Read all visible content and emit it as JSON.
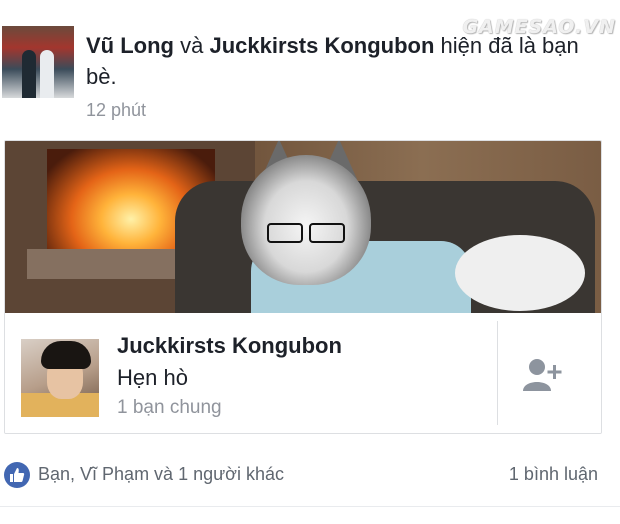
{
  "story": {
    "actor_one": "Vũ Long",
    "connector": "và",
    "actor_two": "Juckkirsts Kongubon",
    "action": "hiện đã là bạn bè.",
    "time": "12 phút"
  },
  "watermark": "GAMESAO.VN",
  "friend_card": {
    "name": "Juckkirsts Kongubon",
    "status": "Hẹn hò",
    "mutual": "1 bạn chung"
  },
  "footer": {
    "reactions": "Bạn, Vĩ Phạm và 1 người khác",
    "comments": "1 bình luận"
  },
  "colors": {
    "accent": "#4267b2",
    "muted": "#90949c",
    "text": "#1d2129"
  },
  "icons": {
    "add_friend": "add-friend-icon",
    "like": "like-thumb-icon"
  }
}
